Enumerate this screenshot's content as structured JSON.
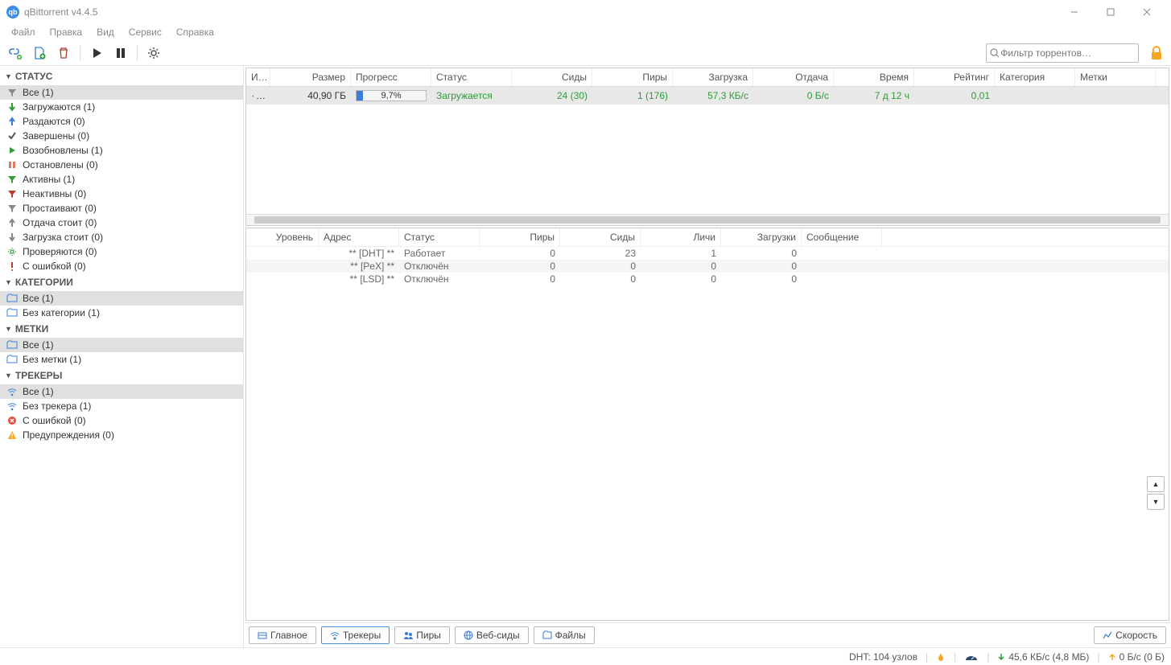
{
  "window": {
    "title": "qBittorrent v4.4.5"
  },
  "menu": [
    "Файл",
    "Правка",
    "Вид",
    "Сервис",
    "Справка"
  ],
  "search": {
    "placeholder": "Фильтр торрентов…"
  },
  "sidebar": {
    "statusHeader": "СТАТУС",
    "status": [
      {
        "icon": "filter",
        "color": "#888",
        "label": "Все (1)",
        "selected": true
      },
      {
        "icon": "down",
        "color": "#2e9c3a",
        "label": "Загружаются (1)"
      },
      {
        "icon": "up",
        "color": "#3b7dd8",
        "label": "Раздаются (0)"
      },
      {
        "icon": "check",
        "color": "#555",
        "label": "Завершены (0)"
      },
      {
        "icon": "play",
        "color": "#2e9c3a",
        "label": "Возобновлены (1)"
      },
      {
        "icon": "pause",
        "color": "#e07a5f",
        "label": "Остановлены (0)"
      },
      {
        "icon": "filter",
        "color": "#2e9c3a",
        "label": "Активны (1)"
      },
      {
        "icon": "filter",
        "color": "#c0392b",
        "label": "Неактивны (0)"
      },
      {
        "icon": "filter",
        "color": "#888",
        "label": "Простаивают (0)"
      },
      {
        "icon": "up",
        "color": "#888",
        "label": "Отдача стоит (0)"
      },
      {
        "icon": "down",
        "color": "#888",
        "label": "Загрузка стоит (0)"
      },
      {
        "icon": "gear",
        "color": "#2e9c3a",
        "label": "Проверяются (0)"
      },
      {
        "icon": "bang",
        "color": "#c0392b",
        "label": "С ошибкой (0)"
      }
    ],
    "categoriesHeader": "КАТЕГОРИИ",
    "categories": [
      {
        "icon": "folder",
        "label": "Все (1)",
        "selected": true
      },
      {
        "icon": "folder",
        "label": "Без категории (1)"
      }
    ],
    "tagsHeader": "МЕТКИ",
    "tags": [
      {
        "icon": "folder",
        "label": "Все (1)",
        "selected": true
      },
      {
        "icon": "folder",
        "label": "Без метки (1)"
      }
    ],
    "trackersHeader": "ТРЕКЕРЫ",
    "trackers": [
      {
        "icon": "tracker",
        "label": "Все (1)",
        "selected": true
      },
      {
        "icon": "tracker",
        "label": "Без трекера (1)"
      },
      {
        "icon": "error",
        "label": "С ошибкой (0)"
      },
      {
        "icon": "warn",
        "label": "Предупреждения (0)"
      }
    ]
  },
  "torrentTable": {
    "columns": [
      "И…",
      "Размер",
      "Прогресс",
      "Статус",
      "Сиды",
      "Пиры",
      "Загрузка",
      "Отдача",
      "Время",
      "Рейтинг",
      "Категория",
      "Метки"
    ],
    "widths": [
      30,
      100,
      100,
      100,
      100,
      100,
      100,
      100,
      100,
      100,
      100,
      100
    ],
    "row": {
      "name": "…",
      "size": "40,90 ГБ",
      "progress": "9,7%",
      "progressPct": 9.7,
      "status": "Загружается",
      "seeds": "24 (30)",
      "peers": "1 (176)",
      "dlspeed": "57,3 КБ/с",
      "upspeed": "0 Б/с",
      "eta": "7 д 12 ч",
      "ratio": "0,01",
      "category": "",
      "tags": ""
    }
  },
  "trackerTable": {
    "columns": [
      "Уровень",
      "Адрес",
      "Статус",
      "Пиры",
      "Сиды",
      "Личи",
      "Загрузки",
      "Сообщение"
    ],
    "widths": [
      90,
      100,
      100,
      100,
      100,
      100,
      100,
      100
    ],
    "rows": [
      {
        "level": "",
        "addr": "** [DHT] **",
        "status": "Работает",
        "peers": "0",
        "seeds": "23",
        "leech": "1",
        "dl": "0",
        "msg": ""
      },
      {
        "level": "",
        "addr": "** [PeX] **",
        "status": "Отключён",
        "peers": "0",
        "seeds": "0",
        "leech": "0",
        "dl": "0",
        "msg": ""
      },
      {
        "level": "",
        "addr": "** [LSD] **",
        "status": "Отключён",
        "peers": "0",
        "seeds": "0",
        "leech": "0",
        "dl": "0",
        "msg": ""
      }
    ]
  },
  "bottomTabs": {
    "general": "Главное",
    "trackers": "Трекеры",
    "peers": "Пиры",
    "webseeds": "Веб-сиды",
    "files": "Файлы",
    "speed": "Скорость"
  },
  "statusbar": {
    "dht": "DHT: 104 узлов",
    "dl": "45,6 КБ/с (4,8 МБ)",
    "ul": "0 Б/с (0 Б)"
  }
}
